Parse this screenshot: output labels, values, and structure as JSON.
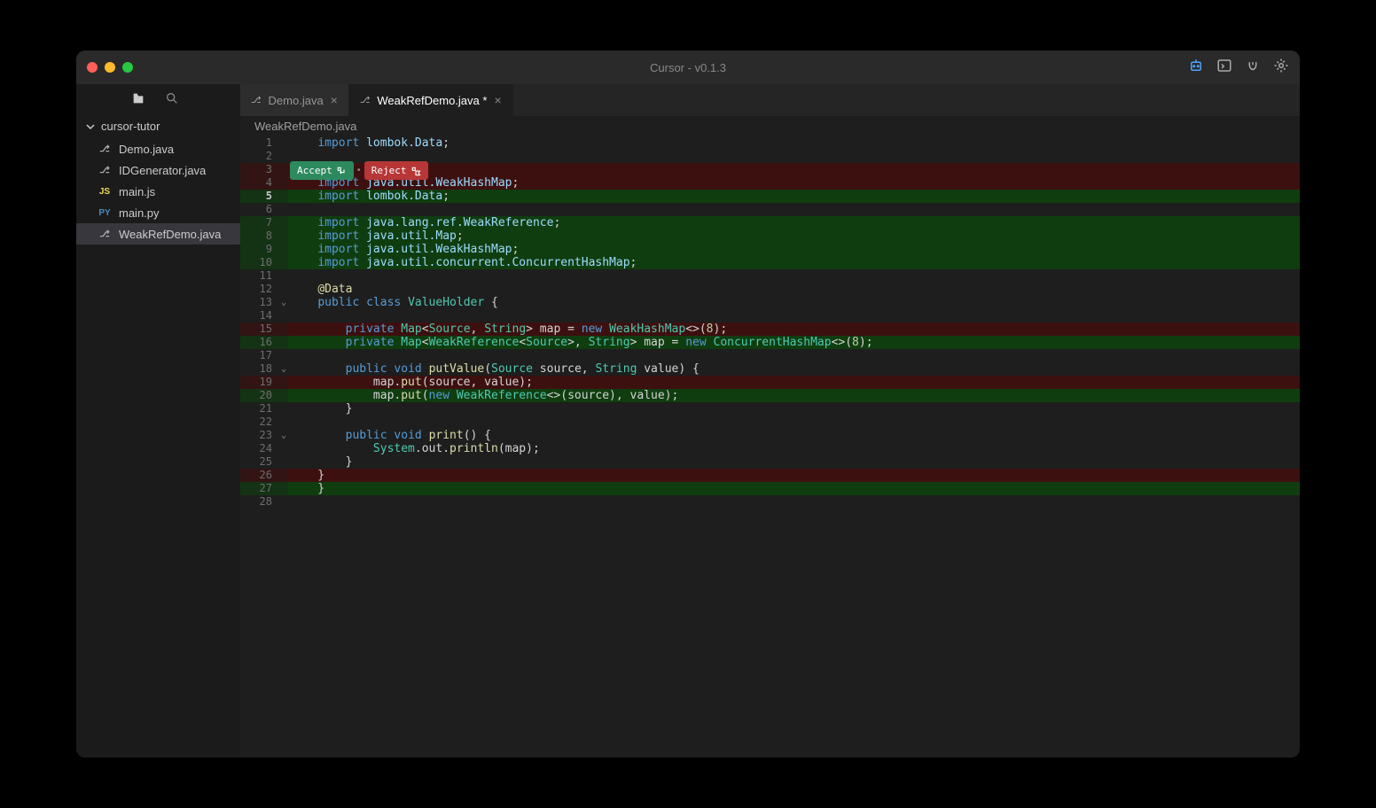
{
  "title": "Cursor - v0.1.3",
  "sidebar": {
    "folder": "cursor-tutor",
    "files": [
      {
        "icon": "java",
        "label": "Demo.java"
      },
      {
        "icon": "java",
        "label": "IDGenerator.java"
      },
      {
        "icon": "js",
        "label": "main.js"
      },
      {
        "icon": "py",
        "label": "main.py"
      },
      {
        "icon": "java",
        "label": "WeakRefDemo.java",
        "active": true
      }
    ]
  },
  "tabs": [
    {
      "icon": "java",
      "label": "Demo.java",
      "close": "×"
    },
    {
      "icon": "java",
      "label": "WeakRefDemo.java *",
      "close": "×",
      "active": true
    }
  ],
  "breadcrumb": "WeakRefDemo.java",
  "widget": {
    "accept": "Accept",
    "reject": "Reject"
  },
  "code": [
    {
      "n": 1,
      "t": "",
      "h": "<span class='kw'>import</span> <span class='pkg'>lombok.Data</span>;"
    },
    {
      "n": 2,
      "t": "",
      "h": ""
    },
    {
      "n": 3,
      "t": "del",
      "h": ""
    },
    {
      "n": 4,
      "t": "del",
      "h": "<span class='kw'>import</span> <span class='pkg'>java.util.WeakHashMap</span>;"
    },
    {
      "n": 5,
      "t": "add",
      "current": true,
      "h": "<span class='kw'>import</span> <span class='pkg'>lombok.Data</span>;"
    },
    {
      "n": 6,
      "t": "",
      "h": ""
    },
    {
      "n": 7,
      "t": "add",
      "h": "<span class='kw'>import</span> <span class='pkg'>java.lang.ref.WeakReference</span>;"
    },
    {
      "n": 8,
      "t": "add",
      "h": "<span class='kw'>import</span> <span class='pkg'>java.util.Map</span>;"
    },
    {
      "n": 9,
      "t": "add",
      "h": "<span class='kw'>import</span> <span class='pkg'>java.util.WeakHashMap</span>;"
    },
    {
      "n": 10,
      "t": "add",
      "h": "<span class='kw'>import</span> <span class='pkg'>java.util.concurrent.ConcurrentHashMap</span>;"
    },
    {
      "n": 11,
      "t": "",
      "h": ""
    },
    {
      "n": 12,
      "t": "",
      "h": "<span class='ann'>@Data</span>"
    },
    {
      "n": 13,
      "t": "",
      "fold": true,
      "h": "<span class='kw'>public</span> <span class='kw'>class</span> <span class='type'>ValueHolder</span> {"
    },
    {
      "n": 14,
      "t": "",
      "h": ""
    },
    {
      "n": 15,
      "t": "del",
      "h": "    <span class='kw'>private</span> <span class='type'>Map</span>&lt;<span class='type'>Source</span>, <span class='type'>String</span>&gt; map = <span class='kw'>new</span> <span class='type'>WeakHashMap</span>&lt;&gt;(<span class='num'>8</span>);"
    },
    {
      "n": 16,
      "t": "add",
      "h": "    <span class='kw'>private</span> <span class='type'>Map</span>&lt;<span class='type'>WeakReference</span>&lt;<span class='type'>Source</span>&gt;, <span class='type'>String</span>&gt; map = <span class='kw'>new</span> <span class='type'>ConcurrentHashMap</span>&lt;&gt;(<span class='num'>8</span>);"
    },
    {
      "n": 17,
      "t": "",
      "h": ""
    },
    {
      "n": 18,
      "t": "",
      "fold": true,
      "h": "    <span class='kw'>public</span> <span class='kw'>void</span> <span class='fn'>putValue</span>(<span class='type'>Source</span> source, <span class='type'>String</span> value) {"
    },
    {
      "n": 19,
      "t": "del",
      "h": "        map.<span class='fn'>put</span>(source, value);"
    },
    {
      "n": 20,
      "t": "add",
      "h": "        map.<span class='fn'>put</span>(<span class='kw'>new</span> <span class='type'>WeakReference</span>&lt;&gt;(source), value);"
    },
    {
      "n": 21,
      "t": "",
      "h": "    }"
    },
    {
      "n": 22,
      "t": "",
      "h": ""
    },
    {
      "n": 23,
      "t": "",
      "fold": true,
      "h": "    <span class='kw'>public</span> <span class='kw'>void</span> <span class='fn'>print</span>() {"
    },
    {
      "n": 24,
      "t": "",
      "h": "        <span class='type'>System</span>.out.<span class='fn'>println</span>(map);"
    },
    {
      "n": 25,
      "t": "",
      "h": "    }"
    },
    {
      "n": 26,
      "t": "del",
      "h": "}"
    },
    {
      "n": 27,
      "t": "add",
      "h": "}"
    },
    {
      "n": 28,
      "t": "",
      "h": ""
    }
  ]
}
